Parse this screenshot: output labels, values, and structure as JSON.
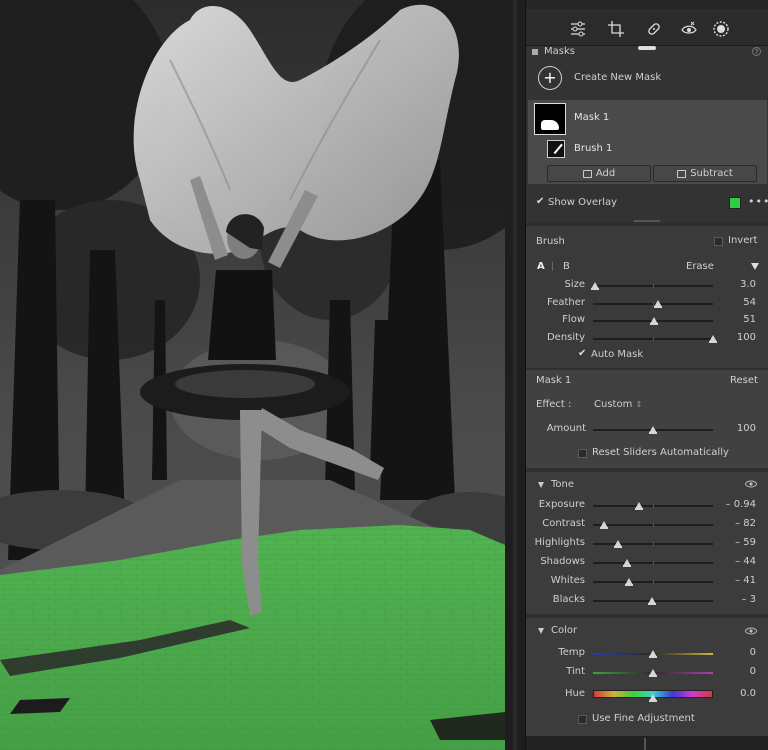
{
  "panel": {
    "tools": [
      {
        "name": "edit-sliders-icon"
      },
      {
        "name": "crop-icon"
      },
      {
        "name": "healing-icon"
      },
      {
        "name": "redeye-icon"
      },
      {
        "name": "masking-icon"
      }
    ],
    "masks_header": "Masks",
    "create_new_mask": "Create New Mask",
    "mask_name": "Mask 1",
    "brush_item": "Brush 1",
    "add_label": "Add",
    "subtract_label": "Subtract",
    "show_overlay": "Show Overlay",
    "overlay_color": "#2ecc40"
  },
  "brush": {
    "title": "Brush",
    "invert": "Invert",
    "tab_a": "A",
    "tab_b": "B",
    "erase": "Erase",
    "sliders": [
      {
        "label": "Size",
        "value": "3.0",
        "pos": 0.02
      },
      {
        "label": "Feather",
        "value": "54",
        "pos": 0.54
      },
      {
        "label": "Flow",
        "value": "51",
        "pos": 0.51
      },
      {
        "label": "Density",
        "value": "100",
        "pos": 1.0
      }
    ],
    "auto_mask": "Auto Mask"
  },
  "mask_effect": {
    "title": "Mask 1",
    "reset": "Reset",
    "effect_label": "Effect :",
    "effect_value": "Custom",
    "amount_label": "Amount",
    "amount_value": "100",
    "amount_pos": 0.5,
    "reset_auto": "Reset Sliders Automatically"
  },
  "tone": {
    "title": "Tone",
    "sliders": [
      {
        "label": "Exposure",
        "value": "– 0.94",
        "pos": 0.38
      },
      {
        "label": "Contrast",
        "value": "– 82",
        "pos": 0.09
      },
      {
        "label": "Highlights",
        "value": "– 59",
        "pos": 0.21
      },
      {
        "label": "Shadows",
        "value": "– 44",
        "pos": 0.28
      },
      {
        "label": "Whites",
        "value": "– 41",
        "pos": 0.3
      },
      {
        "label": "Blacks",
        "value": "– 3",
        "pos": 0.49
      }
    ]
  },
  "color": {
    "title": "Color",
    "sliders": [
      {
        "label": "Temp",
        "value": "0",
        "pos": 0.5
      },
      {
        "label": "Tint",
        "value": "0",
        "pos": 0.5
      },
      {
        "label": "Hue",
        "value": "0.0",
        "pos": 0.5
      }
    ],
    "fine_adjust": "Use Fine Adjustment"
  }
}
